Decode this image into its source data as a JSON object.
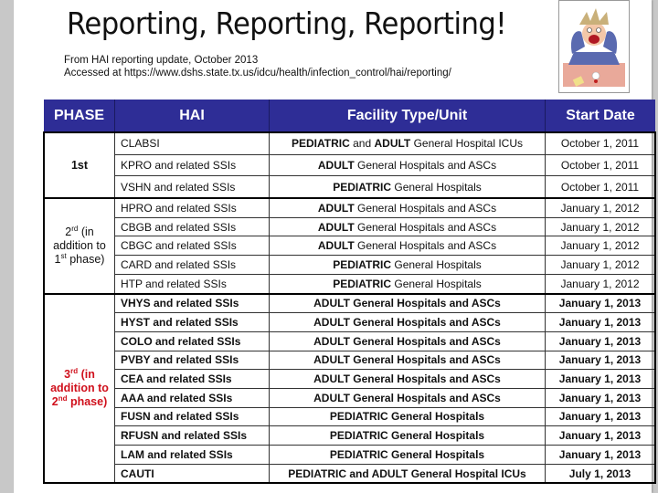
{
  "slide": {
    "title": "Reporting, Reporting, Reporting!",
    "source_line1": "From HAI reporting update, October 2013",
    "source_line2": "Accessed at https://www.dshs.state.tx.us/idcu/health/infection_control/hai/reporting/",
    "cartoon": "stressed-man-at-desk-cartoon"
  },
  "colors": {
    "header_bg": "#2e2d96",
    "phase3_text": "#d0101c"
  },
  "table": {
    "headers": [
      "PHASE",
      "HAI",
      "Facility Type/Unit",
      "Start Date"
    ],
    "phases": [
      {
        "label_main": "1st",
        "rows": [
          {
            "hai": "CLABSI",
            "facility": "PEDIATRIC and ADULT General Hospital ICUs",
            "date": "October 1, 2011"
          },
          {
            "hai": "KPRO and related SSIs",
            "facility": "ADULT General Hospitals and ASCs",
            "date": "October 1, 2011"
          },
          {
            "hai": "VSHN and related SSIs",
            "facility": "PEDIATRIC General Hospitals",
            "date": "October 1, 2011"
          }
        ]
      },
      {
        "label_num": "2",
        "label_sup": "rd",
        "label_a": " (in addition to ",
        "label_num2": "1",
        "label_sup2": "st",
        "label_b": " phase)",
        "rows": [
          {
            "hai": "HPRO and related SSIs",
            "facility": "ADULT General Hospitals and ASCs",
            "date": "January 1, 2012"
          },
          {
            "hai": "CBGB and related SSIs",
            "facility": "ADULT General Hospitals and ASCs",
            "date": "January 1, 2012"
          },
          {
            "hai": "CBGC and related SSIs",
            "facility": "ADULT General Hospitals and ASCs",
            "date": "January 1, 2012"
          },
          {
            "hai": "CARD and related SSIs",
            "facility": "PEDIATRIC General Hospitals",
            "date": "January 1, 2012"
          },
          {
            "hai": "HTP and related SSIs",
            "facility": "PEDIATRIC General Hospitals",
            "date": "January 1, 2012"
          }
        ]
      },
      {
        "label_num": "3",
        "label_sup": "rd",
        "label_a": " (in addition to ",
        "label_num2": "2",
        "label_sup2": "nd",
        "label_b": " phase)",
        "rows": [
          {
            "hai": "VHYS and related SSIs",
            "facility": "ADULT General Hospitals and ASCs",
            "date": "January 1, 2013"
          },
          {
            "hai": "HYST and related SSIs",
            "facility": "ADULT General Hospitals and ASCs",
            "date": "January 1, 2013"
          },
          {
            "hai": "COLO and related SSIs",
            "facility": "ADULT General Hospitals and ASCs",
            "date": "January 1, 2013"
          },
          {
            "hai": "PVBY and related SSIs",
            "facility": "ADULT General Hospitals and ASCs",
            "date": "January 1, 2013"
          },
          {
            "hai": "CEA and related SSIs",
            "facility": "ADULT General Hospitals and ASCs",
            "date": "January 1, 2013"
          },
          {
            "hai": "AAA and related SSIs",
            "facility": "ADULT General Hospitals and ASCs",
            "date": "January 1, 2013"
          },
          {
            "hai": "FUSN and related SSIs",
            "facility": "PEDIATRIC General Hospitals",
            "date": "January 1, 2013"
          },
          {
            "hai": "RFUSN and related SSIs",
            "facility": "PEDIATRIC General Hospitals",
            "date": "January 1, 2013"
          },
          {
            "hai": "LAM and related SSIs",
            "facility": "PEDIATRIC General Hospitals",
            "date": "January 1, 2013"
          },
          {
            "hai": "CAUTI",
            "facility": "PEDIATRIC and ADULT General Hospital ICUs",
            "date": "July 1, 2013"
          }
        ]
      }
    ]
  }
}
